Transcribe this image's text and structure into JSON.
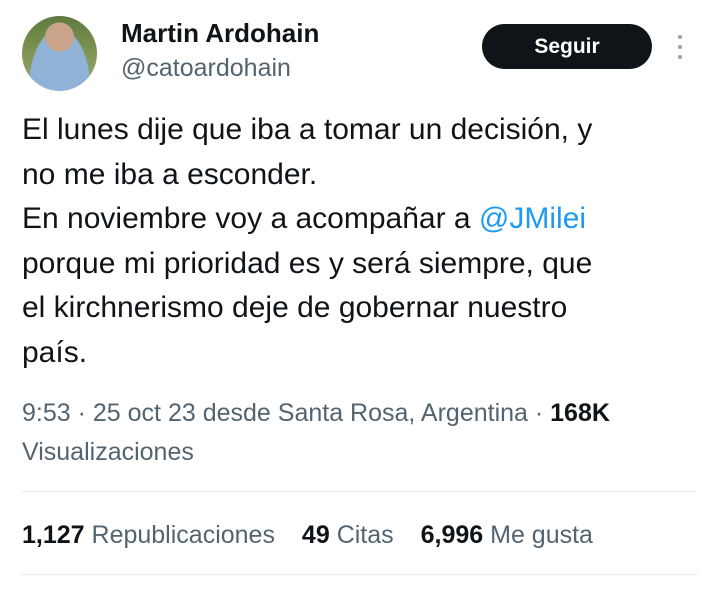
{
  "author": {
    "name": "Martin Ardohain",
    "handle": "@catoardohain",
    "follow_label": "Seguir",
    "more_icon": "more-vertical-icon"
  },
  "tweet": {
    "lines": [
      "El lunes dije que iba a tomar un decisión, y",
      "no me iba a esconder.",
      "En noviembre voy a acompañar a ",
      "porque mi prioridad es y será siempre, que",
      "el kirchnerismo deje de gobernar nuestro",
      "país."
    ],
    "mention": "@JMilei"
  },
  "meta": {
    "time": "9:53",
    "date": "25 oct 23",
    "location": "desde Santa Rosa, Argentina",
    "views_count": "168K",
    "views_label": "Visualizaciones"
  },
  "stats": {
    "reposts_count": "1,127",
    "reposts_label": "Republicaciones",
    "quotes_count": "49",
    "quotes_label": "Citas",
    "likes_count": "6,996",
    "likes_label": "Me gusta"
  },
  "colors": {
    "link": "#1d9bf0",
    "secondary_text": "#536471",
    "button_bg": "#0f1419"
  }
}
